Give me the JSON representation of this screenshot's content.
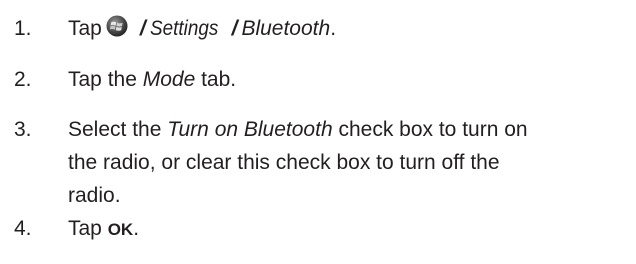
{
  "steps": [
    {
      "number": "1.",
      "text_before_icon": "Tap",
      "icon": "windows-start-icon",
      "sep1": "/",
      "path1": "Settings",
      "sep2": "/",
      "path2": "Bluetooth",
      "end": "."
    },
    {
      "number": "2.",
      "before": "Tap the ",
      "tab_name": "Mode",
      "after": " tab."
    },
    {
      "number": "3.",
      "before": "Select the ",
      "checkbox_name": "Turn on Bluetooth",
      "line1_after": " check box to turn on",
      "line2": "the radio, or clear this check box to turn off the",
      "line3": "radio."
    },
    {
      "number": "4.",
      "before": "Tap ",
      "button_name": "OK",
      "after": "."
    }
  ],
  "colors": {
    "text": "#231f20",
    "background": "#ffffff"
  }
}
